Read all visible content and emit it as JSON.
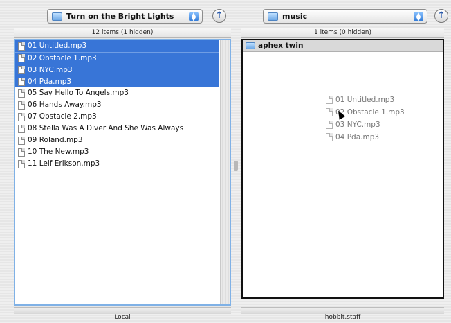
{
  "left": {
    "location_popup": "Turn on the Bright Lights",
    "status": "12 items (1 hidden)",
    "files": [
      {
        "name": "01 Untitled.mp3",
        "selected": true
      },
      {
        "name": "02 Obstacle 1.mp3",
        "selected": true
      },
      {
        "name": "03 NYC.mp3",
        "selected": true
      },
      {
        "name": "04 Pda.mp3",
        "selected": true
      },
      {
        "name": "05 Say Hello To Angels.mp3",
        "selected": false
      },
      {
        "name": "06 Hands Away.mp3",
        "selected": false
      },
      {
        "name": "07 Obstacle 2.mp3",
        "selected": false
      },
      {
        "name": "08 Stella Was A Diver And She Was Always",
        "selected": false
      },
      {
        "name": "09 Roland.mp3",
        "selected": false
      },
      {
        "name": "10 The New.mp3",
        "selected": false
      },
      {
        "name": "11 Leif Erikson.mp3",
        "selected": false
      }
    ],
    "footer": "Local"
  },
  "right": {
    "location_popup": "music",
    "status": "1 items (0 hidden)",
    "folder": "aphex twin",
    "dragging": [
      "01 Untitled.mp3",
      "02 Obstacle 1.mp3",
      "03 NYC.mp3",
      "04 Pda.mp3"
    ],
    "footer": "hobbit.staff"
  },
  "icons": {
    "up_arrow": "up-arrow-icon",
    "popup_arrows": "popup-arrows-icon",
    "folder": "folder-icon",
    "file": "file-icon"
  },
  "colors": {
    "selection": "#3875d7",
    "left_focus_border": "#7fb1e6",
    "drop_target_border": "#111111"
  }
}
